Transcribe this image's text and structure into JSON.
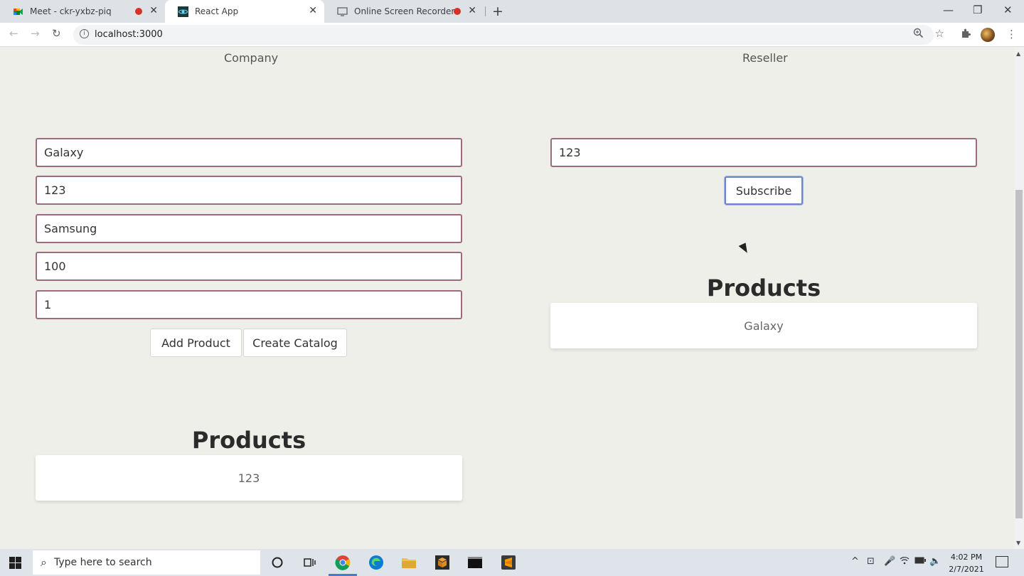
{
  "browser": {
    "tabs": [
      {
        "title": "Meet - ckr-yxbz-piq",
        "recording": true,
        "active": false
      },
      {
        "title": "React App",
        "recording": false,
        "active": true
      },
      {
        "title": "Online Screen Recorder",
        "recording": true,
        "active": false
      }
    ],
    "url": "localhost:3000"
  },
  "company": {
    "heading": "Company",
    "fields": [
      "Galaxy",
      "123",
      "Samsung",
      "100",
      "1"
    ],
    "add_product_label": "Add Product",
    "create_catalog_label": "Create Catalog",
    "products_title": "Products",
    "products": [
      "123"
    ]
  },
  "reseller": {
    "heading": "Reseller",
    "field": "123",
    "subscribe_label": "Subscribe",
    "products_title": "Products",
    "products": [
      "Galaxy"
    ]
  },
  "taskbar": {
    "search_placeholder": "Type here to search",
    "time": "4:02 PM",
    "date": "2/7/2021"
  }
}
